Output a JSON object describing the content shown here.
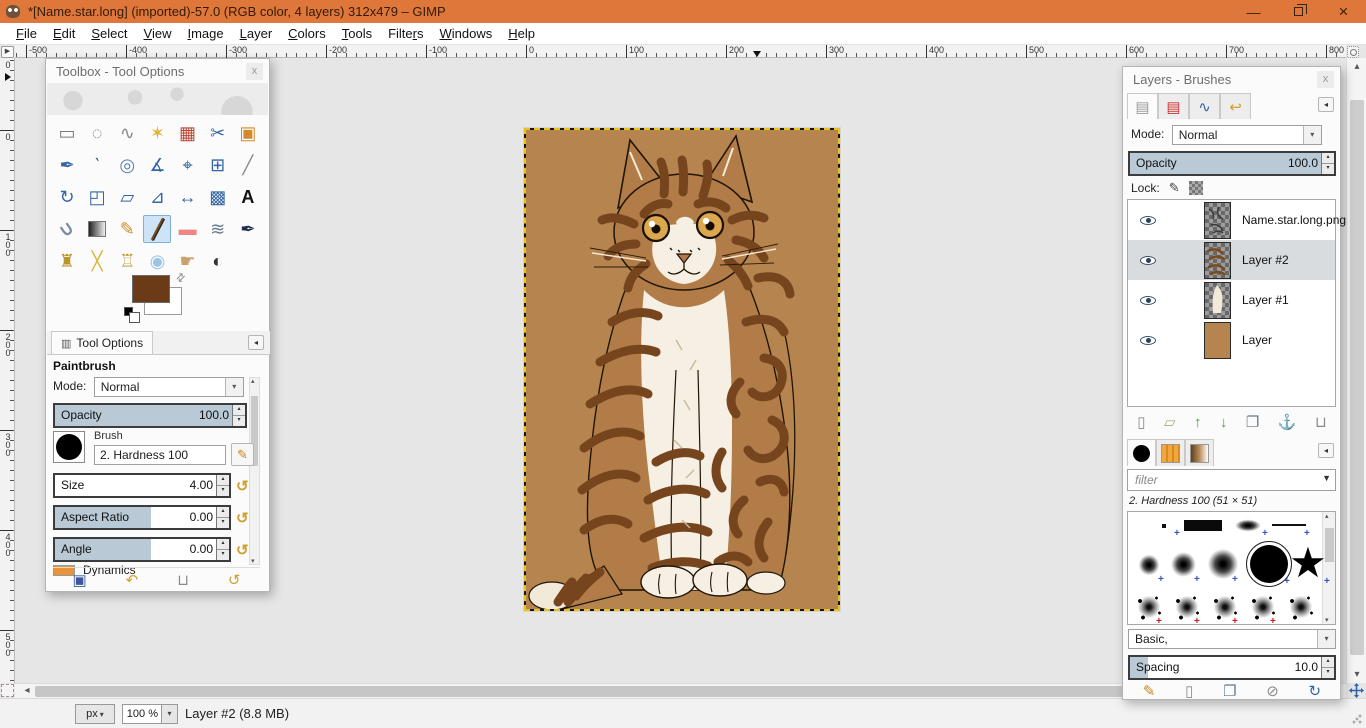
{
  "window": {
    "title": "*[Name.star.long] (imported)-57.0 (RGB color, 4 layers) 312x479 – GIMP",
    "controls": {
      "minimize": "—",
      "restore": "restore",
      "close": "×"
    }
  },
  "menu": {
    "items": [
      {
        "label": "File",
        "mnemonic": 0
      },
      {
        "label": "Edit",
        "mnemonic": 0
      },
      {
        "label": "Select",
        "mnemonic": 0
      },
      {
        "label": "View",
        "mnemonic": 0
      },
      {
        "label": "Image",
        "mnemonic": 0
      },
      {
        "label": "Layer",
        "mnemonic": 0
      },
      {
        "label": "Colors",
        "mnemonic": 0
      },
      {
        "label": "Tools",
        "mnemonic": 0
      },
      {
        "label": "Filters",
        "mnemonic": 5
      },
      {
        "label": "Windows",
        "mnemonic": 0
      },
      {
        "label": "Help",
        "mnemonic": 0
      }
    ]
  },
  "rulers": {
    "horizontal_labels": [
      "-500",
      "-400",
      "-300",
      "-200",
      "-100",
      "0",
      "100",
      "200",
      "300",
      "400",
      "500",
      "600",
      "700",
      "800"
    ],
    "vertical_labels": [
      "0",
      "100",
      "200",
      "300",
      "400",
      "500"
    ],
    "pinned_top_label": "0"
  },
  "toolbox": {
    "title": "Toolbox - Tool Options",
    "tools": [
      {
        "name": "rectangle-select",
        "glyph": "▭",
        "color": "#7a7a7a"
      },
      {
        "name": "ellipse-select",
        "glyph": "◌",
        "color": "#7a7a7a"
      },
      {
        "name": "free-select",
        "glyph": "∿",
        "color": "#8a8a8a"
      },
      {
        "name": "fuzzy-select",
        "glyph": "✶",
        "color": "#e2b232"
      },
      {
        "name": "select-by-color",
        "glyph": "▦",
        "color": "#bb4433"
      },
      {
        "name": "scissors-select",
        "glyph": "✂",
        "color": "#3465a4"
      },
      {
        "name": "foreground-select",
        "glyph": "▣",
        "color": "#d28a2a"
      },
      {
        "name": "paths",
        "glyph": "✒",
        "color": "#3465a4"
      },
      {
        "name": "color-picker",
        "glyph": "‵",
        "color": "#2a4a77"
      },
      {
        "name": "zoom",
        "glyph": "◎",
        "color": "#5a7fae"
      },
      {
        "name": "measure",
        "glyph": "∡",
        "color": "#3465a4"
      },
      {
        "name": "move",
        "glyph": "⌖",
        "color": "#3465a4"
      },
      {
        "name": "align",
        "glyph": "⊞",
        "color": "#3465a4"
      },
      {
        "name": "crop",
        "glyph": "╱",
        "color": "#8a8a8a"
      },
      {
        "name": "rotate",
        "glyph": "↻",
        "color": "#3465a4"
      },
      {
        "name": "scale",
        "glyph": "◰",
        "color": "#3465a4"
      },
      {
        "name": "shear",
        "glyph": "▱",
        "color": "#3465a4"
      },
      {
        "name": "perspective",
        "glyph": "⊿",
        "color": "#3465a4"
      },
      {
        "name": "flip",
        "glyph": "↔",
        "color": "#3465a4"
      },
      {
        "name": "cage-transform",
        "glyph": "▩",
        "color": "#3465a4"
      },
      {
        "name": "text",
        "glyph": "A",
        "color": "#111111"
      },
      {
        "name": "bucket-fill",
        "glyph": "∪",
        "color": "#7a8aa0"
      },
      {
        "name": "gradient",
        "glyph": "",
        "color": ""
      },
      {
        "name": "pencil",
        "glyph": "✎",
        "color": "#d08a28"
      },
      {
        "name": "paintbrush",
        "glyph": "╱",
        "color": "#7a4a1f",
        "active": true
      },
      {
        "name": "eraser",
        "glyph": "▬",
        "color": "#ef8585"
      },
      {
        "name": "airbrush",
        "glyph": "≋",
        "color": "#6a7a8a"
      },
      {
        "name": "ink",
        "glyph": "✒",
        "color": "#1d2d4d"
      },
      {
        "name": "clone",
        "glyph": "♜",
        "color": "#b8962e"
      },
      {
        "name": "heal",
        "glyph": "╳",
        "color": "#d4b63a"
      },
      {
        "name": "perspective-clone",
        "glyph": "♖",
        "color": "#b8962e"
      },
      {
        "name": "blur-sharpen",
        "glyph": "◉",
        "color": "#9cc4e4"
      },
      {
        "name": "smudge",
        "glyph": "☛",
        "color": "#c9a26a"
      },
      {
        "name": "dodge-burn",
        "glyph": "◐",
        "color": "#333333"
      }
    ],
    "colors": {
      "foreground": "#6b3a17",
      "background": "#ffffff"
    },
    "tab_label": "Tool Options",
    "tool_name": "Paintbrush",
    "mode_label": "Mode:",
    "mode_value": "Normal",
    "opacity": {
      "label": "Opacity",
      "value": "100.0"
    },
    "brush": {
      "label": "Brush",
      "value": "2. Hardness 100"
    },
    "sliders": [
      {
        "label": "Size",
        "value": "4.00",
        "fill": 0
      },
      {
        "label": "Aspect Ratio",
        "value": "0.00",
        "fill": 55
      },
      {
        "label": "Angle",
        "value": "0.00",
        "fill": 55
      }
    ],
    "dynamics_label": "Dynamics",
    "footer_icons": [
      {
        "name": "save-tool-preset",
        "glyph": "▣",
        "color": "#3a57a0"
      },
      {
        "name": "restore-tool-preset",
        "glyph": "↶",
        "color": "#d19f2a"
      },
      {
        "name": "delete-tool-preset",
        "glyph": "⊔",
        "color": "#8a8a8a"
      },
      {
        "name": "reset-tool-options",
        "glyph": "↺",
        "color": "#d19f2a"
      }
    ]
  },
  "layers_panel": {
    "title": "Layers - Brushes",
    "dock_tabs": [
      {
        "name": "layers-tab",
        "glyph": "▤",
        "color": "#9a9a9a",
        "selected": true
      },
      {
        "name": "channels-tab",
        "glyph": "▤",
        "color": "#cc3333",
        "selected": false
      },
      {
        "name": "paths-tab",
        "glyph": "∿",
        "color": "#3465a4",
        "selected": false
      },
      {
        "name": "undo-history-tab",
        "glyph": "↩",
        "color": "#d19f2a",
        "selected": false
      }
    ],
    "mode_label": "Mode:",
    "mode_value": "Normal",
    "opacity": {
      "label": "Opacity",
      "value": "100.0"
    },
    "lock_label": "Lock:",
    "layers": [
      {
        "name": "Name.star.long.png",
        "thumb": "lineart",
        "selected": false
      },
      {
        "name": "Layer #2",
        "thumb": "stripes",
        "selected": true
      },
      {
        "name": "Layer #1",
        "thumb": "whitecat",
        "selected": false
      },
      {
        "name": "Layer",
        "thumb": "solid",
        "selected": false
      }
    ],
    "footer_icons": [
      {
        "name": "new-layer",
        "glyph": "▯",
        "color": "#8a8a8a"
      },
      {
        "name": "new-layer-group",
        "glyph": "▱",
        "color": "#b0a878"
      },
      {
        "name": "raise-layer",
        "glyph": "↑",
        "color": "#3aa63a"
      },
      {
        "name": "lower-layer",
        "glyph": "↓",
        "color": "#3aa63a"
      },
      {
        "name": "duplicate-layer",
        "glyph": "❐",
        "color": "#667788"
      },
      {
        "name": "anchor-layer",
        "glyph": "⚓",
        "color": "#8a8a8a"
      },
      {
        "name": "delete-layer",
        "glyph": "⊔",
        "color": "#8a8a8a"
      }
    ],
    "brushes": {
      "filter_placeholder": "filter",
      "current_brush": "2. Hardness 100 (51 × 51)",
      "items": [
        {
          "name": "brush-tiny-dot",
          "type": "dot"
        },
        {
          "name": "brush-block",
          "type": "bar"
        },
        {
          "name": "brush-soft-ellipse",
          "type": "ellipse"
        },
        {
          "name": "brush-thin-line",
          "type": "line"
        },
        {
          "name": "brush-hardness-025",
          "type": "soft1"
        },
        {
          "name": "brush-hardness-050",
          "type": "soft2"
        },
        {
          "name": "brush-hardness-075",
          "type": "soft3"
        },
        {
          "name": "brush-hardness-100",
          "type": "hard",
          "selected": true
        },
        {
          "name": "brush-star",
          "type": "star"
        },
        {
          "name": "brush-splatter-1",
          "type": "splat"
        },
        {
          "name": "brush-splatter-2",
          "type": "splat"
        },
        {
          "name": "brush-splatter-3",
          "type": "splat"
        },
        {
          "name": "brush-splatter-4",
          "type": "splat"
        },
        {
          "name": "brush-splatter-5",
          "type": "splat"
        }
      ],
      "group_value": "Basic,",
      "spacing": {
        "label": "Spacing",
        "value": "10.0"
      },
      "footer_icons": [
        {
          "name": "edit-brush",
          "glyph": "✎",
          "color": "#c8861e"
        },
        {
          "name": "new-brush",
          "glyph": "▯",
          "color": "#8a8a8a"
        },
        {
          "name": "duplicate-brush",
          "glyph": "❐",
          "color": "#667788"
        },
        {
          "name": "delete-brush",
          "glyph": "⊘",
          "color": "#8a8a8a"
        },
        {
          "name": "refresh-brushes",
          "glyph": "↻",
          "color": "#3465a4"
        }
      ]
    }
  },
  "statusbar": {
    "unit": "px",
    "zoom": "100 %",
    "message": "Layer #2 (8.8 MB)"
  },
  "canvas": {
    "background_color": "#b6854f",
    "stripe_color": "#76451d",
    "subject": "tabby cat drawing"
  }
}
